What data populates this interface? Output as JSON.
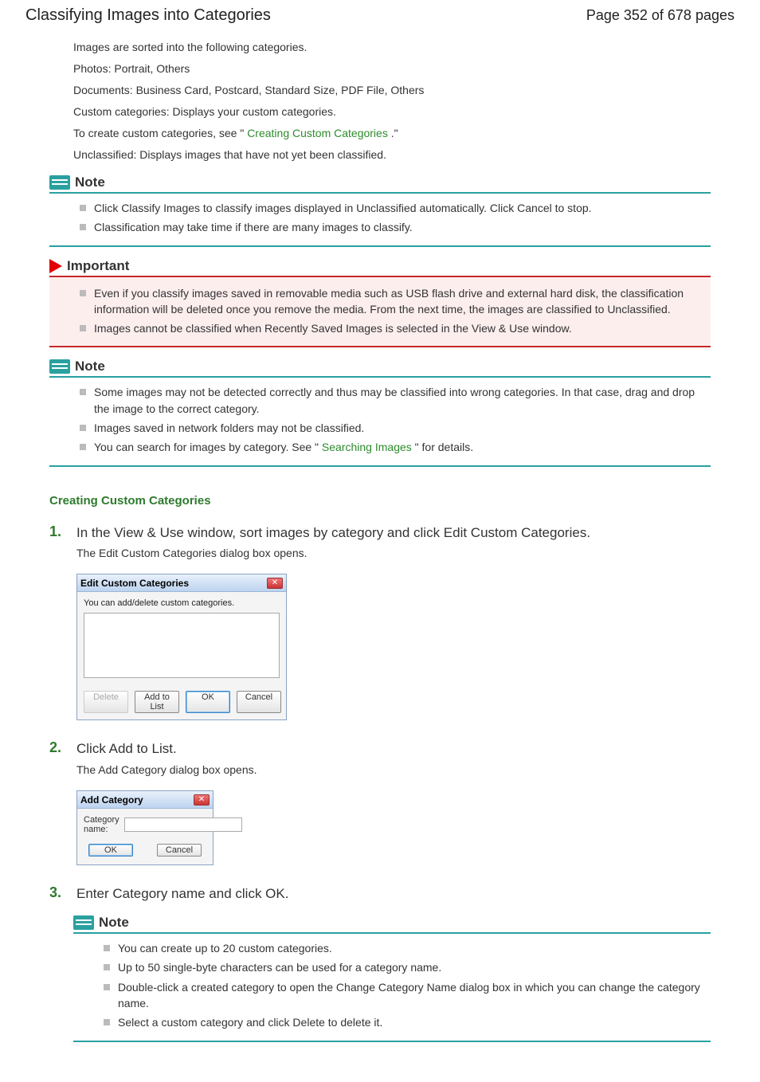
{
  "header": {
    "title": "Classifying Images into Categories",
    "pageIndicator": "Page 352 of 678 pages"
  },
  "intro": {
    "p1": "Images are sorted into the following categories.",
    "p2": "Photos: Portrait, Others",
    "p3": "Documents: Business Card, Postcard, Standard Size, PDF File, Others",
    "p4": "Custom categories: Displays your custom categories.",
    "p5a": "To create custom categories, see \"",
    "p5link": "Creating Custom Categories",
    "p5b": ".\"",
    "p6": "Unclassified: Displays images that have not yet been classified."
  },
  "note1": {
    "title": "Note",
    "items": [
      "Click Classify Images to classify images displayed in Unclassified automatically. Click Cancel to stop.",
      "Classification may take time if there are many images to classify."
    ]
  },
  "important1": {
    "title": "Important",
    "items": [
      "Even if you classify images saved in removable media such as USB flash drive and external hard disk, the classification information will be deleted once you remove the media. From the next time, the images are classified to Unclassified.",
      "Images cannot be classified when Recently Saved Images is selected in the View & Use window."
    ]
  },
  "note2": {
    "title": "Note",
    "items": {
      "i1": "Some images may not be detected correctly and thus may be classified into wrong categories. In that case, drag and drop the image to the correct category.",
      "i2": "Images saved in network folders may not be classified.",
      "i3a": "You can search for images by category. See \"",
      "i3link": "Searching Images",
      "i3b": "\" for details."
    }
  },
  "section": {
    "heading": "Creating Custom Categories"
  },
  "steps": {
    "s1": {
      "num": "1.",
      "text": "In the View & Use window, sort images by category and click Edit Custom Categories.",
      "sub": "The Edit Custom Categories dialog box opens."
    },
    "s2": {
      "num": "2.",
      "text": "Click Add to List.",
      "sub": "The Add Category dialog box opens."
    },
    "s3": {
      "num": "3.",
      "text": "Enter Category name and click OK."
    }
  },
  "dialog1": {
    "title": "Edit Custom Categories",
    "instruction": "You can add/delete custom categories.",
    "buttons": {
      "delete": "Delete",
      "add": "Add to List",
      "ok": "OK",
      "cancel": "Cancel"
    }
  },
  "dialog2": {
    "title": "Add Category",
    "fieldLabel": "Category name:",
    "fieldValue": "",
    "buttons": {
      "ok": "OK",
      "cancel": "Cancel"
    }
  },
  "note3": {
    "title": "Note",
    "items": [
      "You can create up to 20 custom categories.",
      "Up to 50 single-byte characters can be used for a category name.",
      "Double-click a created category to open the Change Category Name dialog box in which you can change the category name.",
      "Select a custom category and click Delete to delete it."
    ]
  }
}
